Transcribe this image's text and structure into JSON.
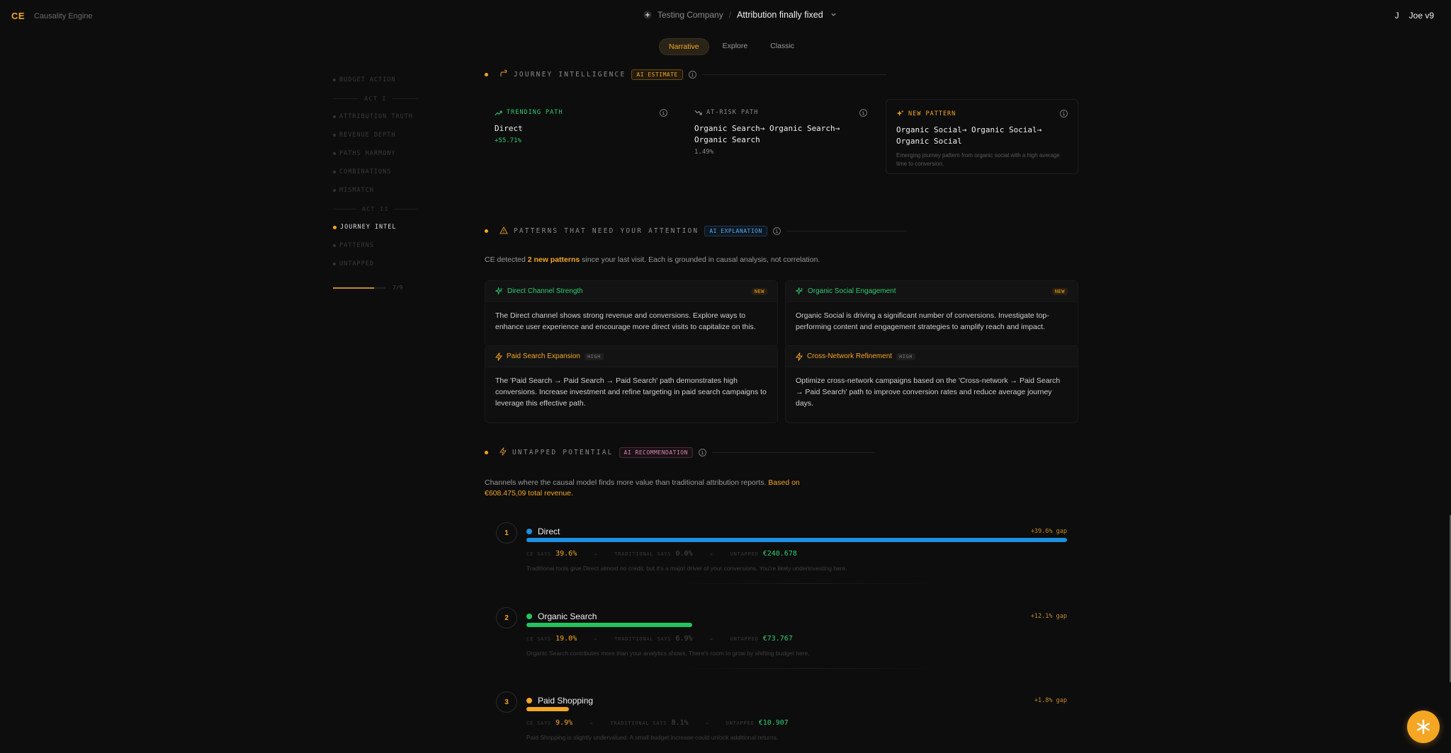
{
  "app": {
    "logo": "CE",
    "name": "Causality Engine"
  },
  "breadcrumb": {
    "company": "Testing Company",
    "separator": "/",
    "project": "Attribution finally fixed"
  },
  "user": {
    "initial": "J",
    "name": "Joe v9"
  },
  "view_tabs": [
    {
      "label": "Narrative",
      "active": true
    },
    {
      "label": "Explore",
      "active": false
    },
    {
      "label": "Classic",
      "active": false
    }
  ],
  "rail": {
    "items": [
      {
        "label": "BUDGET ACTION",
        "type": "item"
      },
      {
        "label": "ACT I",
        "type": "act"
      },
      {
        "label": "ATTRIBUTION TRUTH",
        "type": "item"
      },
      {
        "label": "REVENUE DEPTH",
        "type": "item"
      },
      {
        "label": "PATHS HARMONY",
        "type": "item"
      },
      {
        "label": "COMBINATIONS",
        "type": "item"
      },
      {
        "label": "MISMATCH",
        "type": "item"
      },
      {
        "label": "ACT II",
        "type": "act"
      },
      {
        "label": "JOURNEY INTEL",
        "type": "item",
        "active": true
      },
      {
        "label": "PATTERNS",
        "type": "item"
      },
      {
        "label": "UNTAPPED",
        "type": "item"
      }
    ],
    "progress_label": "7/9",
    "progress_fraction": 0.778
  },
  "journey": {
    "title": "JOURNEY INTELLIGENCE",
    "badge": "AI ESTIMATE",
    "cards": [
      {
        "label": "TRENDING PATH",
        "path": "Direct",
        "stat": "+55.71%",
        "desc": ""
      },
      {
        "label": "AT-RISK PATH",
        "path": "Organic Search→ Organic Search→ Organic Search",
        "stat": "1.49%",
        "desc": ""
      },
      {
        "label": "NEW PATTERN",
        "path": "Organic Social→ Organic Social→ Organic Social",
        "stat": "",
        "desc": "Emerging journey pattern from organic social with a high average time to conversion."
      }
    ]
  },
  "patterns": {
    "title": "PATTERNS THAT NEED YOUR ATTENTION",
    "badge": "AI EXPLANATION",
    "intro_pre": "CE detected ",
    "intro_hl": "2 new patterns",
    "intro_post": " since your last visit. Each is grounded in causal analysis, not correlation.",
    "cards": [
      {
        "title": "Direct Channel Strength",
        "tag": "NEW",
        "body": "The Direct channel shows strong revenue and conversions. Explore ways to enhance user experience and encourage more direct visits to capitalize on this."
      },
      {
        "title": "Organic Social Engagement",
        "tag": "NEW",
        "body": "Organic Social is driving a significant number of conversions. Investigate top-performing content and engagement strategies to amplify reach and impact."
      },
      {
        "title": "Paid Search Expansion",
        "tag": "HIGH",
        "body": "The 'Paid Search → Paid Search → Paid Search' path demonstrates high conversions. Increase investment and refine targeting in paid search campaigns to leverage this effective path."
      },
      {
        "title": "Cross-Network Refinement",
        "tag": "HIGH",
        "body": "Optimize cross-network campaigns based on the 'Cross-network → Paid Search → Paid Search' path to improve conversion rates and reduce average journey days."
      }
    ]
  },
  "untapped": {
    "title": "UNTAPPED POTENTIAL",
    "badge": "AI RECOMMENDATION",
    "intro_pre": "Channels where the causal model finds more value than traditional attribution reports. ",
    "intro_line2_a": "Based on",
    "intro_line2_b": "€608.475,09 total revenue.",
    "labels": {
      "ce": "CE SAYS",
      "trad": "TRADITIONAL SAYS",
      "untapped": "UNTAPPED",
      "arrow": "→"
    },
    "rows": [
      {
        "rank": "1",
        "name": "Direct",
        "color": "#1e8fe1",
        "fill": 1.0,
        "gap": "+39.6% gap",
        "ce": "39.6%",
        "trad": "0.0%",
        "untapped": "€240.678",
        "note": "Traditional tools give Direct almost no credit, but it's a major driver of your conversions. You're likely underinvesting here."
      },
      {
        "rank": "2",
        "name": "Organic Search",
        "color": "#22c55e",
        "fill": 0.307,
        "gap": "+12.1% gap",
        "ce": "19.0%",
        "trad": "6.9%",
        "untapped": "€73.767",
        "note": "Organic Search contributes more than your analytics shows. There's room to grow by shifting budget here."
      },
      {
        "rank": "3",
        "name": "Paid Shopping",
        "color": "#f5a623",
        "fill": 0.079,
        "gap": "+1.8% gap",
        "ce": "9.9%",
        "trad": "8.1%",
        "untapped": "€10.907",
        "note": "Paid Shopping is slightly undervalued. A small budget increase could unlock additional returns."
      }
    ]
  },
  "colors": {
    "accent": "#f5a623",
    "green": "#2ecc71",
    "blue": "#1e8fe1",
    "background": "#0d0d0d"
  }
}
